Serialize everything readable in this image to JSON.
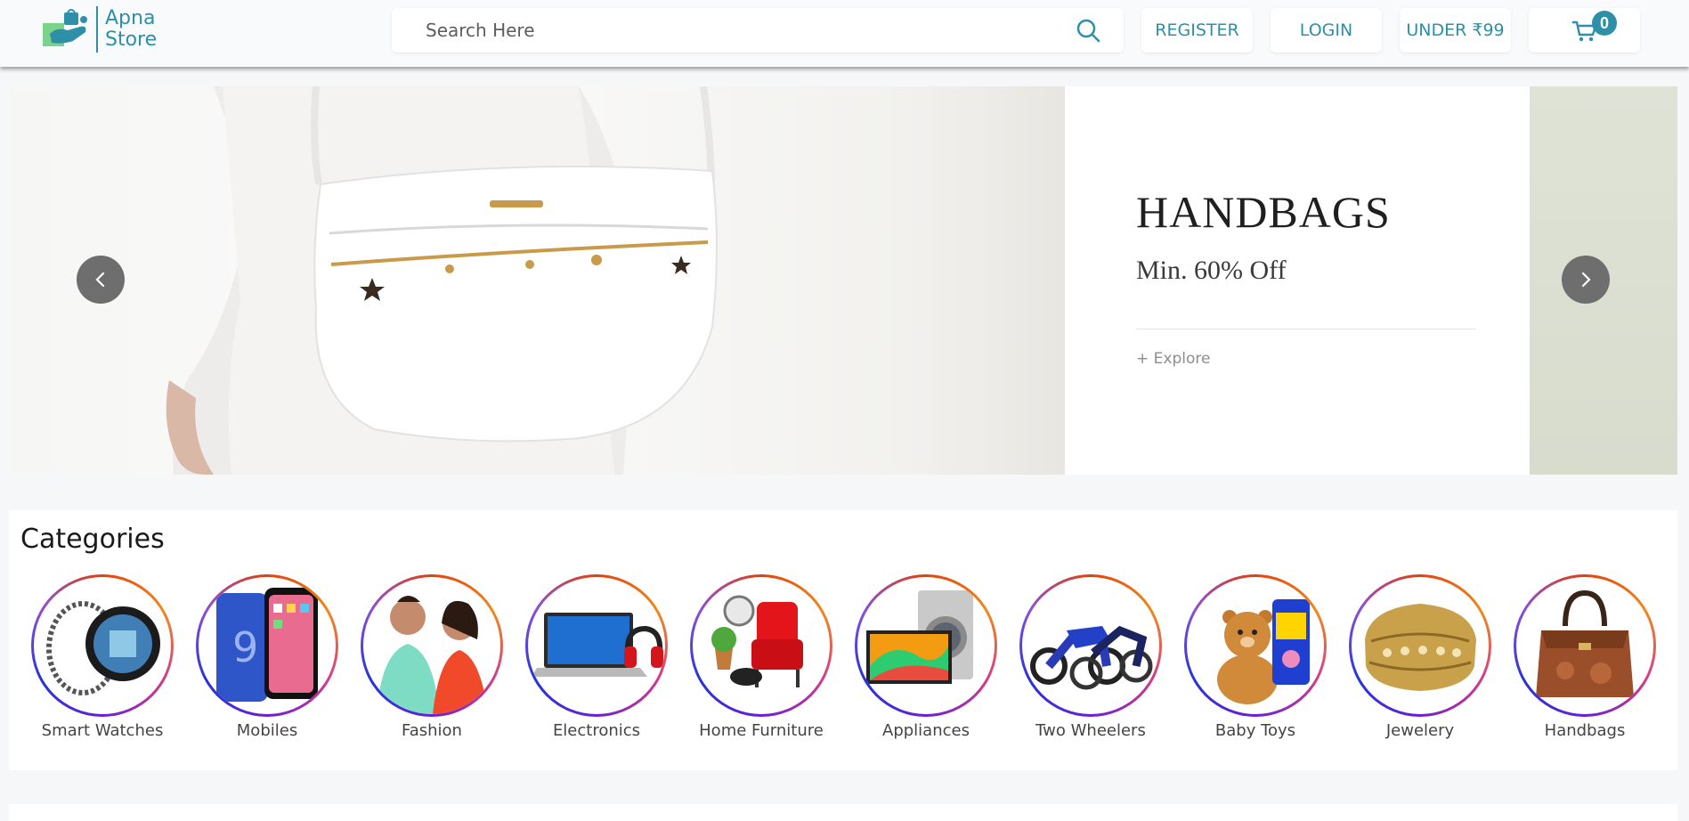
{
  "header": {
    "logo_line1": "Apna",
    "logo_line2": "Store",
    "search_placeholder": "Search Here",
    "register_label": "REGISTER",
    "login_label": "LOGIN",
    "under_label": "UNDER ₹99",
    "cart_count": "0",
    "accent_color": "#2d8fa8"
  },
  "banner": {
    "title": "HANDBAGS",
    "subtitle": "Min. 60% Off",
    "link": "+ Explore",
    "prev_icon": "chevron-left-icon",
    "next_icon": "chevron-right-icon"
  },
  "categories": {
    "title": "Categories",
    "items": [
      {
        "label": "Smart Watches"
      },
      {
        "label": "Mobiles"
      },
      {
        "label": "Fashion"
      },
      {
        "label": "Electronics"
      },
      {
        "label": "Home Furniture"
      },
      {
        "label": "Appliances"
      },
      {
        "label": "Two Wheelers"
      },
      {
        "label": "Baby Toys"
      },
      {
        "label": "Jewelery"
      },
      {
        "label": "Handbags"
      }
    ]
  }
}
